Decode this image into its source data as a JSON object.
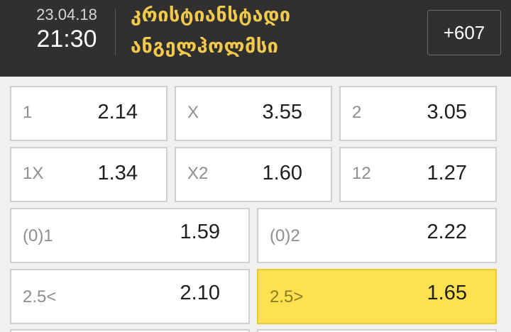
{
  "match": {
    "date": "23.04.18",
    "time": "21:30",
    "team1": "კრისტიანსტადი",
    "team2": "ანგელჰოლმსი",
    "more_markets": "+607"
  },
  "odds_rows": [
    [
      {
        "label": "1",
        "value": "2.14"
      },
      {
        "label": "X",
        "value": "3.55"
      },
      {
        "label": "2",
        "value": "3.05"
      }
    ],
    [
      {
        "label": "1X",
        "value": "1.34"
      },
      {
        "label": "X2",
        "value": "1.60"
      },
      {
        "label": "12",
        "value": "1.27"
      }
    ],
    [
      {
        "label": "(0)1",
        "value": "1.59"
      },
      {
        "label": "(0)2",
        "value": "2.22"
      }
    ],
    [
      {
        "label": "2.5<",
        "value": "2.10"
      },
      {
        "label": "2.5>",
        "value": "1.65",
        "selected": true
      }
    ]
  ],
  "colors": {
    "header_bg": "#303030",
    "team_name": "#f2c94c",
    "selected_bg": "#fde14e"
  }
}
